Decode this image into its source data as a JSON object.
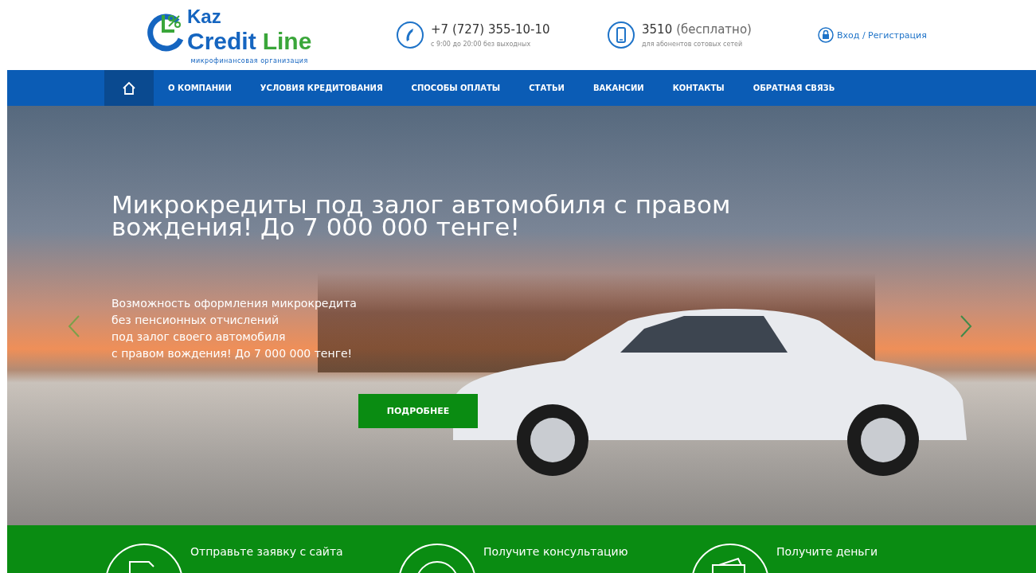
{
  "header": {
    "logo": {
      "line1": "Kaz",
      "line2a": "Credit",
      "line2b": "Line",
      "subtitle": "микрофинансовая организация"
    },
    "contacts": [
      {
        "kind": "phone",
        "main": "+7 (727) 355-10-10",
        "note": "с 9:00 до 20:00 без выходных"
      },
      {
        "kind": "mobile",
        "main": "3510",
        "extra": "(бесплатно)",
        "note": "для абонентов сотовых сетей"
      }
    ],
    "login": {
      "text": "Вход / Регистрация"
    }
  },
  "nav": [
    {
      "kind": "home",
      "selected": true
    },
    {
      "kind": "link",
      "label": "О КОМПАНИИ",
      "selected": false
    },
    {
      "kind": "link",
      "label": "УСЛОВИЯ КРЕДИТОВАНИЯ",
      "selected": false
    },
    {
      "kind": "link",
      "label": "СПОСОБЫ ОПЛАТЫ",
      "selected": false
    },
    {
      "kind": "link",
      "label": "СТАТЬИ",
      "selected": false
    },
    {
      "kind": "link",
      "label": "ВАКАНСИИ",
      "selected": false
    },
    {
      "kind": "link",
      "label": "КОНТАКТЫ",
      "selected": false
    },
    {
      "kind": "link",
      "label": "ОБРАТНАЯ СВЯЗЬ",
      "selected": false
    }
  ],
  "hero": {
    "title_lines": [
      "Микрокредиты под залог автомобиля с правом",
      "вождения! До 7 000 000 тенге!"
    ],
    "text_lines": [
      "Возможность оформления микрокредита",
      "без пенсионных отчислений",
      "под залог своего автомобиля",
      "с правом вождения! До 7 000 000 тенге!"
    ],
    "button": "ПОДРОБНЕЕ"
  },
  "steps": [
    {
      "kind": "document",
      "label": "Отправьте заявку с сайта"
    },
    {
      "kind": "clock",
      "label": "Получите консультацию"
    },
    {
      "kind": "wallet",
      "label": "Получите деньги"
    }
  ]
}
